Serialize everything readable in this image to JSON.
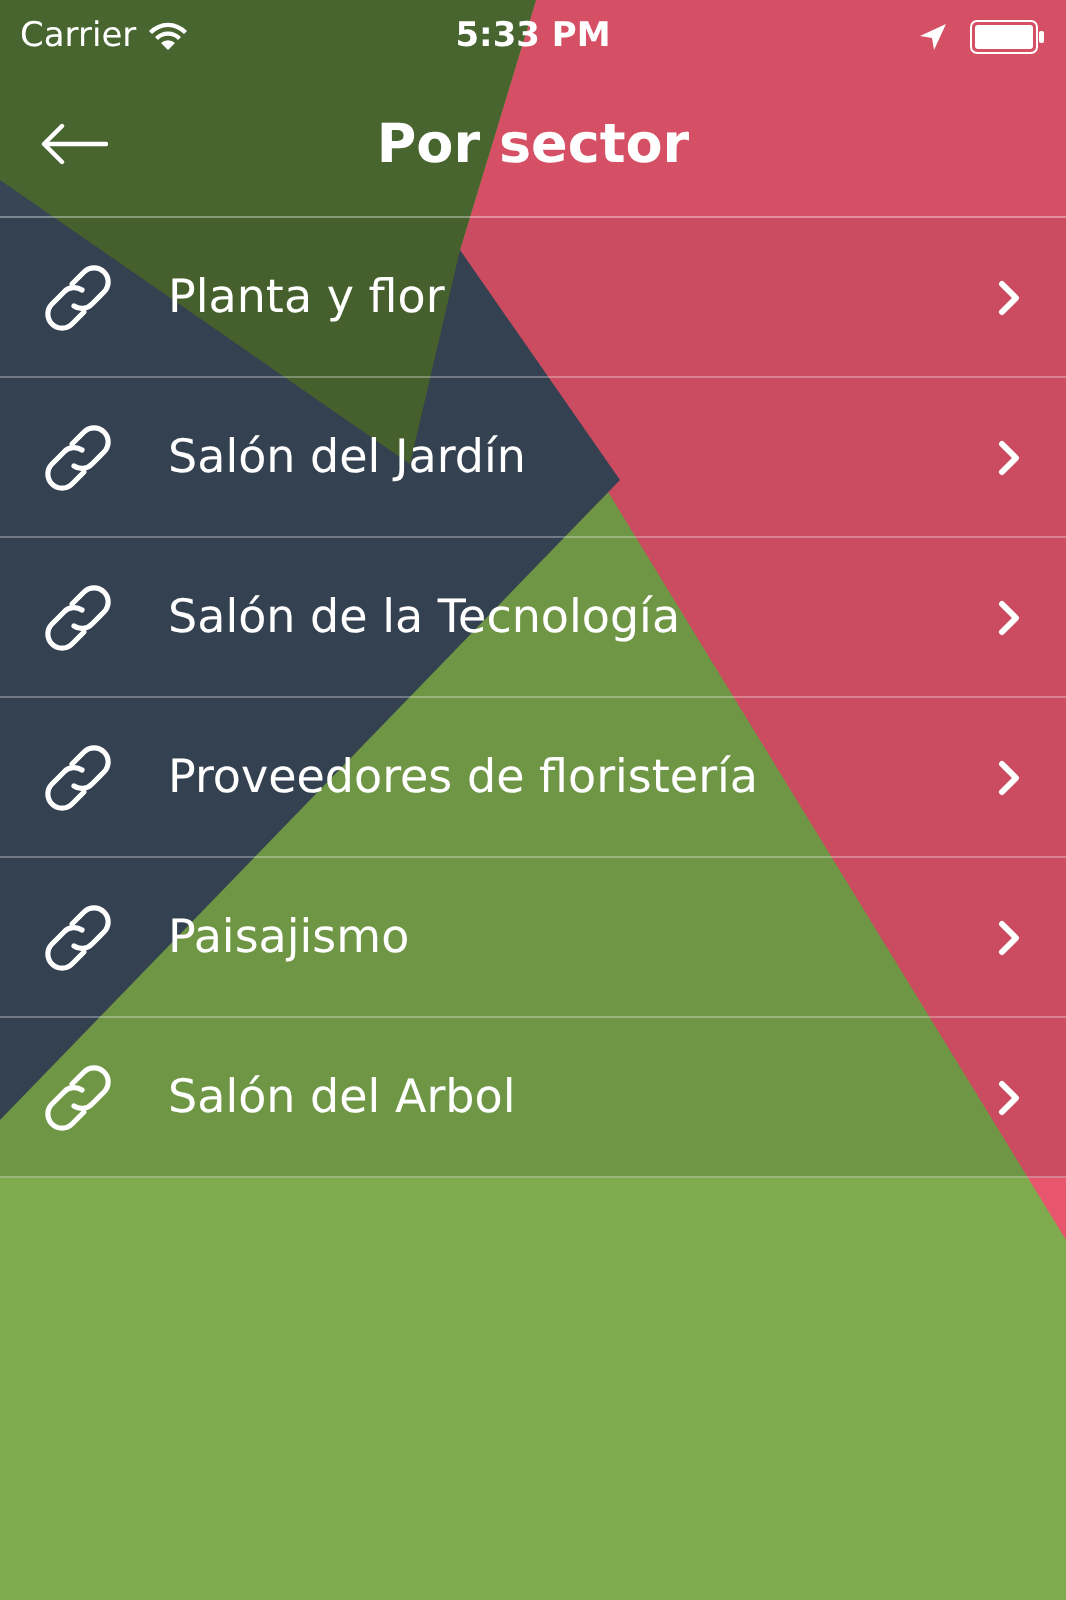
{
  "status_bar": {
    "carrier": "Carrier",
    "time": "5:33 PM"
  },
  "header": {
    "title": "Por sector"
  },
  "items": [
    {
      "label": "Planta y flor"
    },
    {
      "label": "Salón del Jardín"
    },
    {
      "label": "Salón de la Tecnología"
    },
    {
      "label": "Proveedores de floristería"
    },
    {
      "label": "Paisajismo"
    },
    {
      "label": "Salón del Arbol"
    }
  ]
}
